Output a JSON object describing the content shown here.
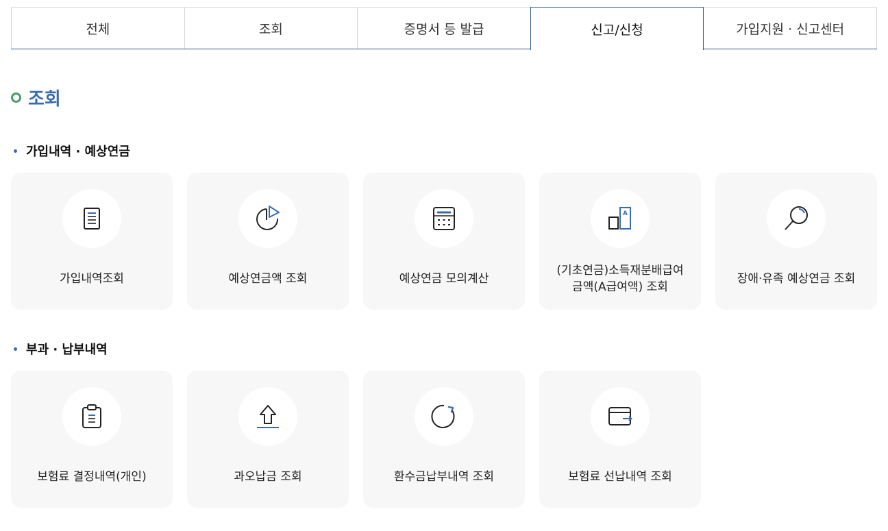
{
  "tabs": [
    {
      "label": "전체",
      "active": false
    },
    {
      "label": "조회",
      "active": false
    },
    {
      "label": "증명서 등 발급",
      "active": false
    },
    {
      "label": "신고/신청",
      "active": true
    },
    {
      "label": "가입지원 · 신고센터",
      "active": false
    }
  ],
  "page_title": "조회",
  "sections": [
    {
      "heading": "가입내역 · 예상연금",
      "cards": [
        {
          "label": "가입내역조회",
          "icon": "document-icon"
        },
        {
          "label": "예상연금액 조회",
          "icon": "pie-chart-icon"
        },
        {
          "label": "예상연금 모의계산",
          "icon": "calculator-icon"
        },
        {
          "label": "(기초연금)소득재분배급여\n금액(A급여액) 조회",
          "icon": "bar-a-icon"
        },
        {
          "label": "장애·유족 예상연금 조회",
          "icon": "search-icon"
        }
      ]
    },
    {
      "heading": "부과 · 납부내역",
      "cards": [
        {
          "label": "보험료 결정내역(개인)",
          "icon": "clipboard-icon"
        },
        {
          "label": "과오납금 조회",
          "icon": "upload-arrow-icon"
        },
        {
          "label": "환수금납부내역 조회",
          "icon": "refresh-icon"
        },
        {
          "label": "보험료 선납내역 조회",
          "icon": "wallet-icon"
        }
      ]
    }
  ],
  "colors": {
    "accent": "#3a6bb0",
    "ring": "#4a9a6a",
    "card_bg": "#f7f7f7"
  }
}
